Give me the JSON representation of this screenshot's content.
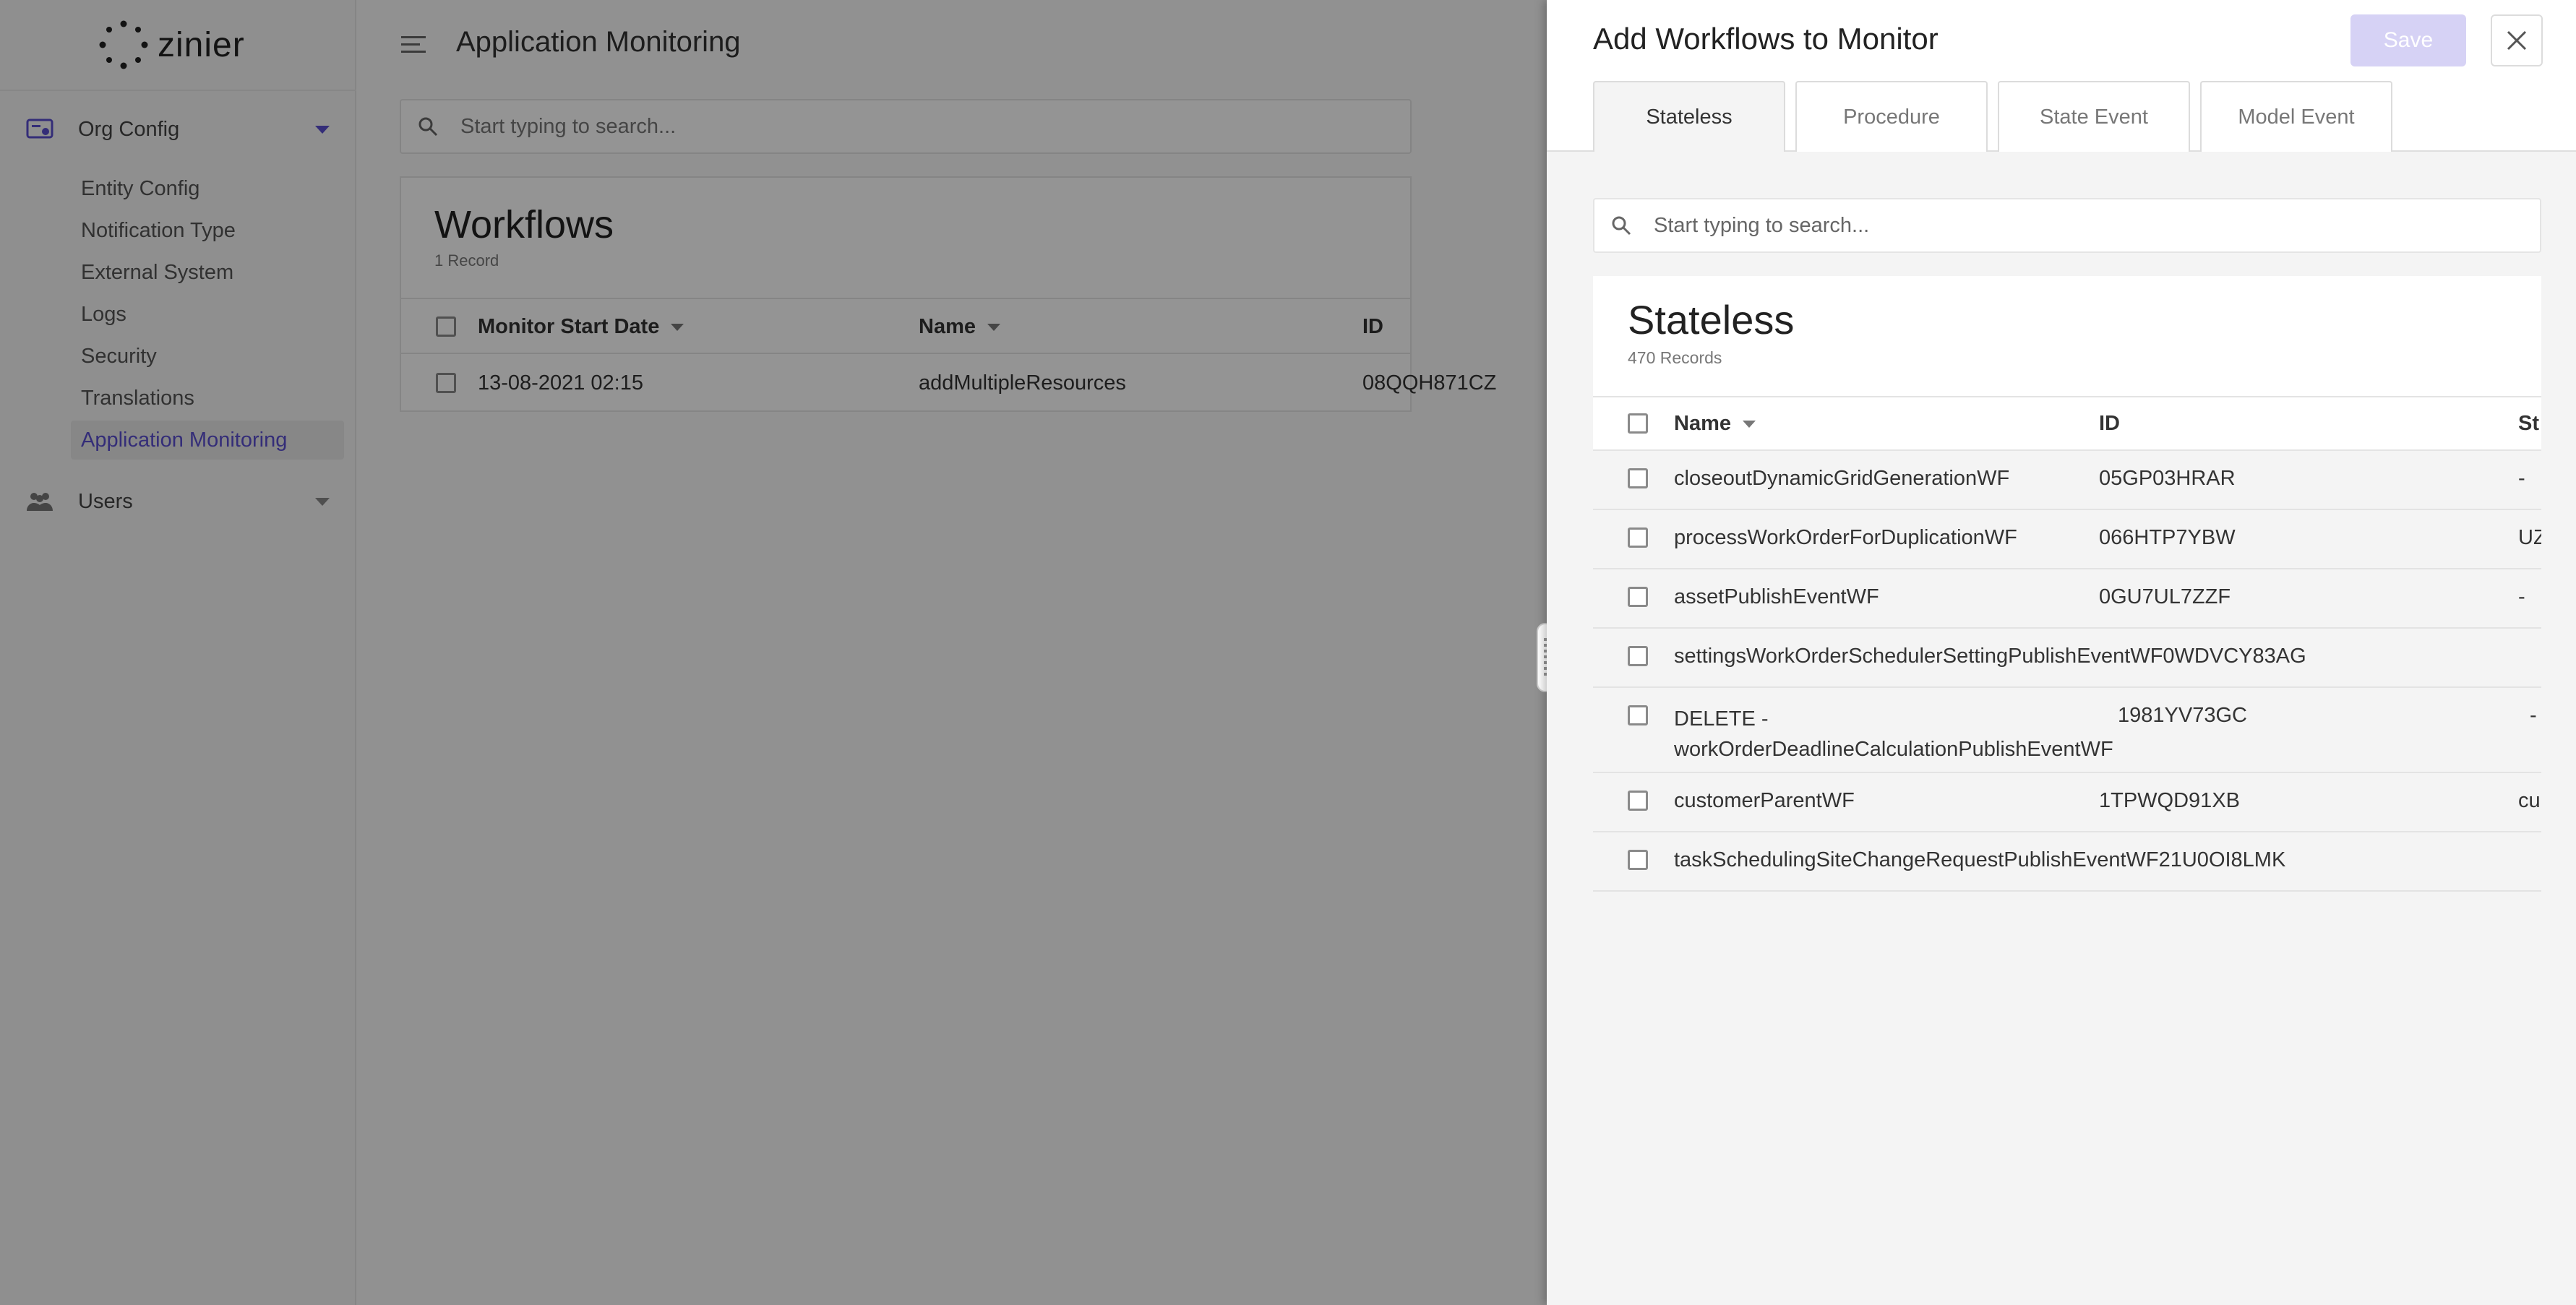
{
  "app": {
    "brand": "zinier",
    "page_title": "Application Monitoring"
  },
  "sidebar": {
    "groups": [
      {
        "label": "Org Config",
        "icon": "org-config-icon",
        "expanded": true
      },
      {
        "label": "Users",
        "icon": "users-icon",
        "expanded": false
      }
    ],
    "items": [
      {
        "label": "Entity Config",
        "active": false
      },
      {
        "label": "Notification Type",
        "active": false
      },
      {
        "label": "External System",
        "active": false
      },
      {
        "label": "Logs",
        "active": false
      },
      {
        "label": "Security",
        "active": false
      },
      {
        "label": "Translations",
        "active": false
      },
      {
        "label": "Application Monitoring",
        "active": true
      }
    ]
  },
  "main": {
    "search_placeholder": "Start typing to search...",
    "workflows": {
      "title": "Workflows",
      "count": "1 Record",
      "columns": [
        "Monitor Start Date",
        "Name",
        "ID"
      ],
      "rows": [
        {
          "date": "13-08-2021 02:15",
          "name": "addMultipleResources",
          "id": "08QQH871CZ"
        }
      ]
    }
  },
  "drawer": {
    "title": "Add Workflows to Monitor",
    "save_label": "Save",
    "tabs": [
      "Stateless",
      "Procedure",
      "State Event",
      "Model Event"
    ],
    "active_tab": "Stateless",
    "search_placeholder": "Start typing to search...",
    "list": {
      "title": "Stateless",
      "count": "470 Records",
      "columns": [
        "Name",
        "ID",
        "St"
      ],
      "rows": [
        {
          "name": "closeoutDynamicGridGenerationWF",
          "id": "05GP03HRAR",
          "status": "-"
        },
        {
          "name": "processWorkOrderForDuplicationWF",
          "id": "066HTP7YBW",
          "status": "UZ"
        },
        {
          "name": "assetPublishEventWF",
          "id": "0GU7UL7ZZF",
          "status": "-"
        },
        {
          "name": "settingsWorkOrderSchedulerSettingPublishEventWF0WDVCY83AG",
          "id": "",
          "status": ""
        },
        {
          "name": "DELETE - workOrderDeadlineCalculationPublishEventWF",
          "id": "1981YV73GC",
          "status": "-"
        },
        {
          "name": "customerParentWF",
          "id": "1TPWQD91XB",
          "status": "cu"
        },
        {
          "name": "taskSchedulingSiteChangeRequestPublishEventWF21U0OI8LMK",
          "id": "",
          "status": ""
        }
      ]
    }
  },
  "colors": {
    "accent": "#5a4fcf",
    "save_disabled": "#d6d2f5",
    "overlay": "rgba(0,0,0,0.42)"
  }
}
